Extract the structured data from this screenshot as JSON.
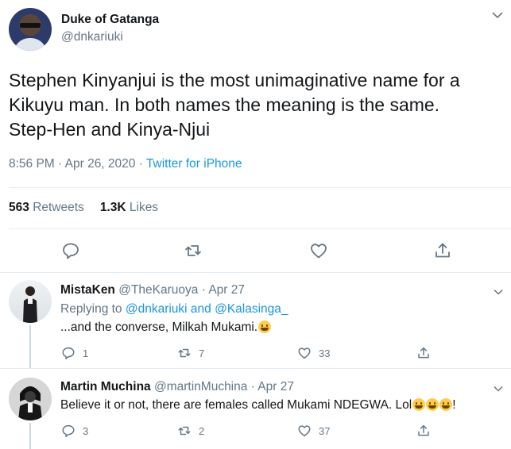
{
  "tweet": {
    "author": {
      "name": "Duke of Gatanga",
      "handle": "@dnkariuki"
    },
    "text": "Stephen Kinyanjui is the most unimaginative name for a\nKikuyu man. In both names the meaning is the same.\nStep-Hen and Kinya-Njui",
    "time": "8:56 PM · Apr 26, 2020 · ",
    "source": "Twitter for iPhone",
    "stats": {
      "retweets_count": "563",
      "retweets_label": "Retweets",
      "likes_count": "1.3K",
      "likes_label": "Likes"
    },
    "actions": [
      "reply-icon",
      "retweet-icon",
      "like-icon",
      "share-icon"
    ]
  },
  "replies": [
    {
      "name": "MistaKen",
      "handle": "@TheKaruoya · Apr 27",
      "replying_prefix": "Replying to ",
      "replying_to": "@dnkariuki and @Kalasinga_",
      "text": "...and the converse, Milkah Mukami.",
      "emojis": [
        "grinning-emoji"
      ],
      "counts": {
        "replies": "1",
        "retweets": "7",
        "likes": "33"
      }
    },
    {
      "name": "Martin Muchina",
      "handle": "@martinMuchina · Apr 27",
      "text": "Believe it or not, there are females called Mukami NDEGWA. Lol",
      "emojis": [
        "sweat-smile-emoji",
        "joy-emoji",
        "smile-emoji"
      ],
      "text_suffix": "!",
      "counts": {
        "replies": "3",
        "retweets": "2",
        "likes": "37"
      }
    }
  ],
  "colors": {
    "text": "#14171a",
    "secondary": "#657786",
    "link": "#1b95e0",
    "divider": "#e6ecf0"
  }
}
